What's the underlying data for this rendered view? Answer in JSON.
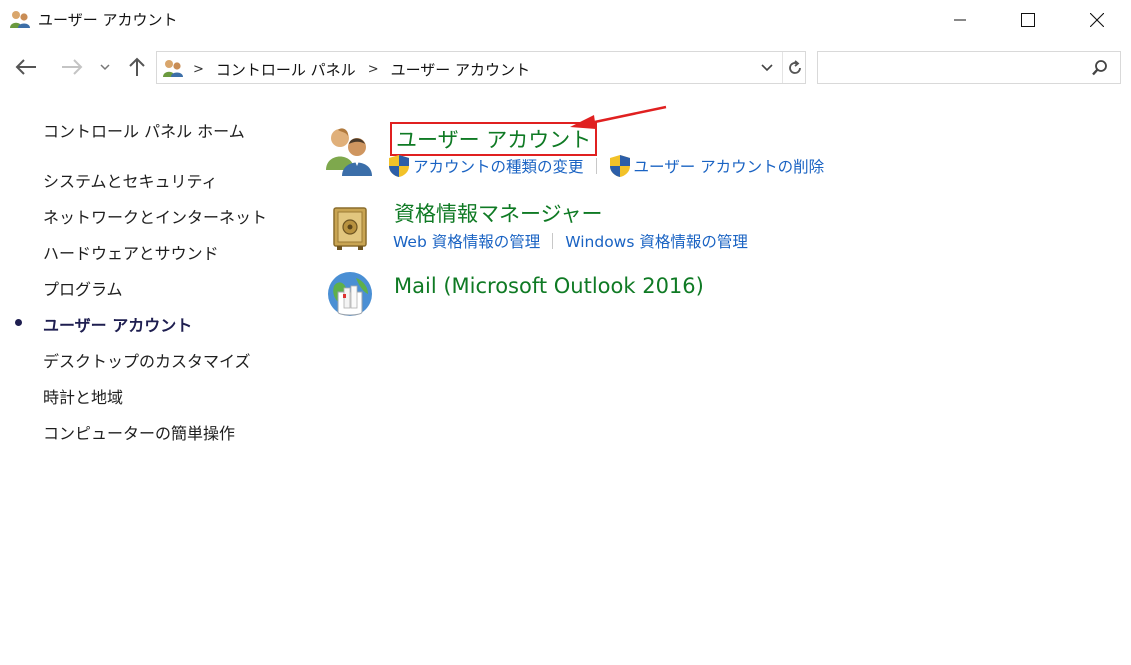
{
  "window": {
    "title": "ユーザー アカウント"
  },
  "address": {
    "crumbs": [
      "コントロール パネル",
      "ユーザー アカウント"
    ],
    "separator": ">"
  },
  "search": {
    "placeholder": ""
  },
  "sidebar": {
    "home": "コントロール パネル ホーム",
    "items": [
      {
        "label": "システムとセキュリティ",
        "active": false
      },
      {
        "label": "ネットワークとインターネット",
        "active": false
      },
      {
        "label": "ハードウェアとサウンド",
        "active": false
      },
      {
        "label": "プログラム",
        "active": false
      },
      {
        "label": "ユーザー アカウント",
        "active": true
      },
      {
        "label": "デスクトップのカスタマイズ",
        "active": false
      },
      {
        "label": "時計と地域",
        "active": false
      },
      {
        "label": "コンピューターの簡単操作",
        "active": false
      }
    ]
  },
  "main": {
    "categories": [
      {
        "title": "ユーザー アカウント",
        "icon": "users-icon",
        "links": [
          "アカウントの種類の変更",
          "ユーザー アカウントの削除"
        ]
      },
      {
        "title": "資格情報マネージャー",
        "icon": "vault-icon",
        "links": [
          "Web 資格情報の管理",
          "Windows 資格情報の管理"
        ]
      },
      {
        "title": "Mail (Microsoft Outlook 2016)",
        "icon": "mail-globe-icon",
        "links": []
      }
    ]
  },
  "colors": {
    "category_title": "#0f7a24",
    "link": "#1a63c3",
    "highlight_box": "#e02020",
    "arrow": "#e02020"
  }
}
